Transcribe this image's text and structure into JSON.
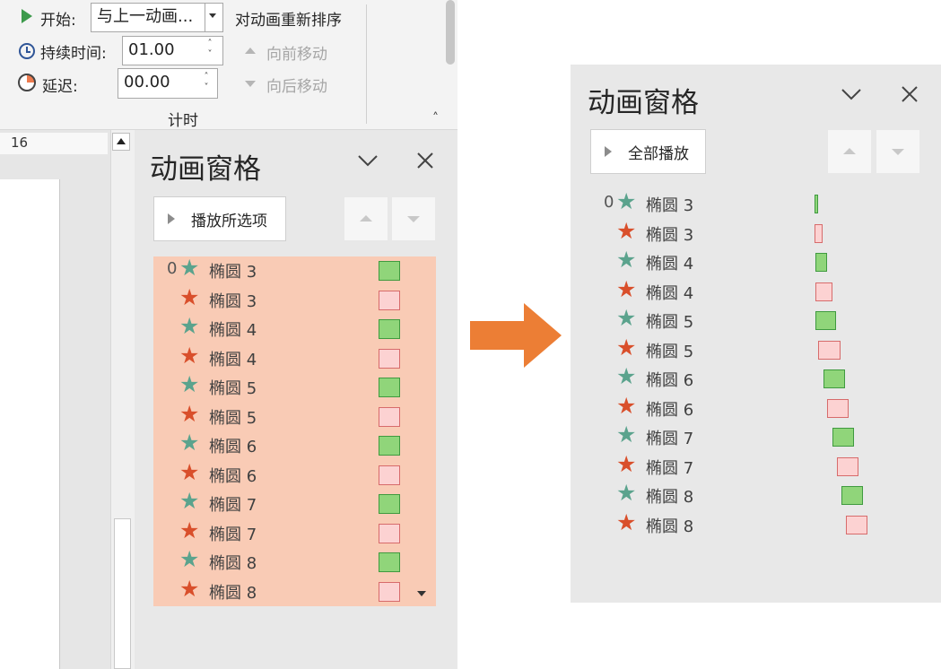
{
  "ribbon": {
    "start_label": "开始:",
    "start_value": "与上一动画...",
    "duration_label": "持续时间:",
    "duration_value": "01.00",
    "delay_label": "延迟:",
    "delay_value": "00.00",
    "reorder_title": "对动画重新排序",
    "move_earlier": "向前移动",
    "move_later": "向后移动",
    "group_label": "计时"
  },
  "ruler": {
    "mark": "16"
  },
  "left_pane": {
    "title": "动画窗格",
    "play_button": "播放所选项",
    "items": [
      {
        "index": "0",
        "effect": "green",
        "label": "椭圆 3"
      },
      {
        "index": "",
        "effect": "red",
        "label": "椭圆 3"
      },
      {
        "index": "",
        "effect": "green",
        "label": "椭圆 4"
      },
      {
        "index": "",
        "effect": "red",
        "label": "椭圆 4"
      },
      {
        "index": "",
        "effect": "green",
        "label": "椭圆 5"
      },
      {
        "index": "",
        "effect": "red",
        "label": "椭圆 5"
      },
      {
        "index": "",
        "effect": "green",
        "label": "椭圆 6"
      },
      {
        "index": "",
        "effect": "red",
        "label": "椭圆 6"
      },
      {
        "index": "",
        "effect": "green",
        "label": "椭圆 7"
      },
      {
        "index": "",
        "effect": "red",
        "label": "椭圆 7"
      },
      {
        "index": "",
        "effect": "green",
        "label": "椭圆 8"
      },
      {
        "index": "",
        "effect": "red",
        "label": "椭圆 8"
      }
    ]
  },
  "right_pane": {
    "title": "动画窗格",
    "play_button": "全部播放",
    "items": [
      {
        "index": "0",
        "effect": "green",
        "label": "椭圆 3"
      },
      {
        "index": "",
        "effect": "red",
        "label": "椭圆 3"
      },
      {
        "index": "",
        "effect": "green",
        "label": "椭圆 4"
      },
      {
        "index": "",
        "effect": "red",
        "label": "椭圆 4"
      },
      {
        "index": "",
        "effect": "green",
        "label": "椭圆 5"
      },
      {
        "index": "",
        "effect": "red",
        "label": "椭圆 5"
      },
      {
        "index": "",
        "effect": "green",
        "label": "椭圆 6"
      },
      {
        "index": "",
        "effect": "red",
        "label": "椭圆 6"
      },
      {
        "index": "",
        "effect": "green",
        "label": "椭圆 7"
      },
      {
        "index": "",
        "effect": "red",
        "label": "椭圆 7"
      },
      {
        "index": "",
        "effect": "green",
        "label": "椭圆 8"
      },
      {
        "index": "",
        "effect": "red",
        "label": "椭圆 8"
      }
    ]
  },
  "colors": {
    "effect_green_star": "#5ba38d",
    "effect_red_star": "#d94f2b",
    "bar_green": "#90d57a",
    "bar_red": "#fcd2d2",
    "selection": "#f9cbb5",
    "arrow": "#ec7e35"
  },
  "icons": {
    "star": "★",
    "close": "✕",
    "collapse": "chevron-down-icon"
  }
}
